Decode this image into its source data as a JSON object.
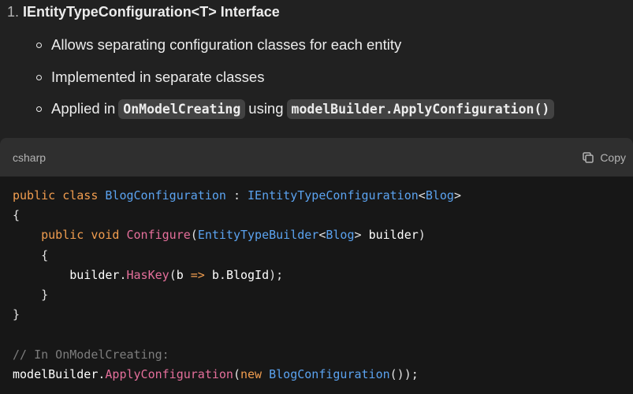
{
  "heading": {
    "number": "1.",
    "title": "IEntityTypeConfiguration<T> Interface"
  },
  "bullets": [
    {
      "text": "Allows separating configuration classes for each entity"
    },
    {
      "text": "Implemented in separate classes"
    },
    {
      "pre": "Applied in",
      "code1": "OnModelCreating",
      "mid": "using",
      "code2": "modelBuilder.ApplyConfiguration()"
    }
  ],
  "code_block": {
    "language": "csharp",
    "copy_label": "Copy",
    "tokens": {
      "public": "public",
      "class": "class",
      "void": "void",
      "new": "new",
      "blog_configuration": "BlogConfiguration",
      "i_entity_type_configuration": "IEntityTypeConfiguration",
      "blog": "Blog",
      "configure": "Configure",
      "entity_type_builder": "EntityTypeBuilder",
      "builder": "builder",
      "has_key": "HasKey",
      "b": "b",
      "arrow": "=>",
      "blog_id": "BlogId",
      "comment": "// In OnModelCreating:",
      "model_builder": "modelBuilder",
      "apply_configuration": "ApplyConfiguration"
    }
  },
  "colors": {
    "background": "#212121",
    "code_background": "#171717",
    "code_header": "#2f2f2f",
    "keyword": "#f19d4f",
    "type": "#5ba3f0",
    "method": "#e56f9b",
    "comment": "#7d7d7d"
  }
}
